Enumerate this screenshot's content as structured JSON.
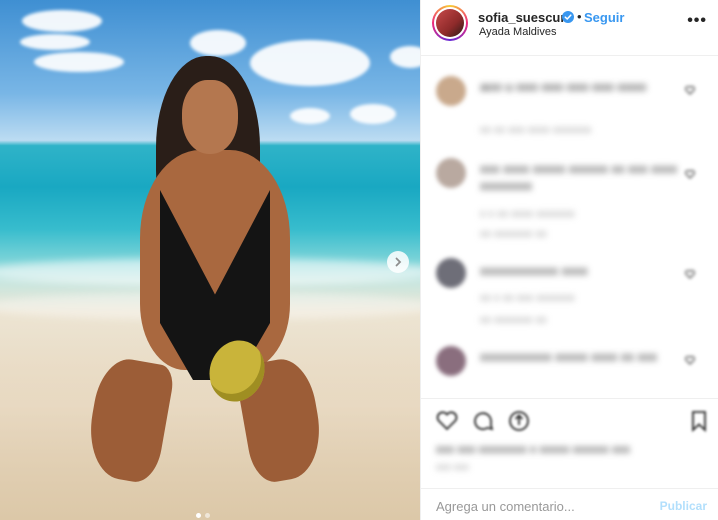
{
  "post": {
    "username": "sofia_suescun",
    "verified": true,
    "separator": "•",
    "follow_label": "Seguir",
    "location": "Ayada Maldives",
    "more_label": "•••"
  },
  "photo": {
    "description_icon": "beach-photo",
    "carousel_dots": 3,
    "next_icon": "chevron-right-icon"
  },
  "comments": [
    {
      "text": "aoo u ooo ooo ooo ooo oooo",
      "meta": "xx xx  xxx xxxx  xxxxxxx"
    },
    {
      "text": "xxx xxxx xxxxx xxxxxx xx xxx xxxx xxxxxxxx",
      "meta": "x x  xx xxxx  xxxxxxx",
      "sub": "xx xxxxxxx xx"
    },
    {
      "text": "xxxxxxxxxxxx xxxx",
      "meta": "xx x  xx xxx  xxxxxxx",
      "sub": "xx xxxxxxx xx"
    },
    {
      "text": "xxxxxxxxxxx xxxxx xxxx xx xxx",
      "meta": ""
    }
  ],
  "actions": {
    "likes_text": "xxx xxx xxxxxxxx x xxxxx xxxxxx xxx",
    "time_text": "xxx xxx"
  },
  "comment_box": {
    "placeholder": "Agrega un comentario...",
    "publish_label": "Publicar"
  },
  "colors": {
    "link_blue": "#3897f0",
    "publish_disabled": "#b2dffc",
    "verified_blue": "#3897f0"
  }
}
